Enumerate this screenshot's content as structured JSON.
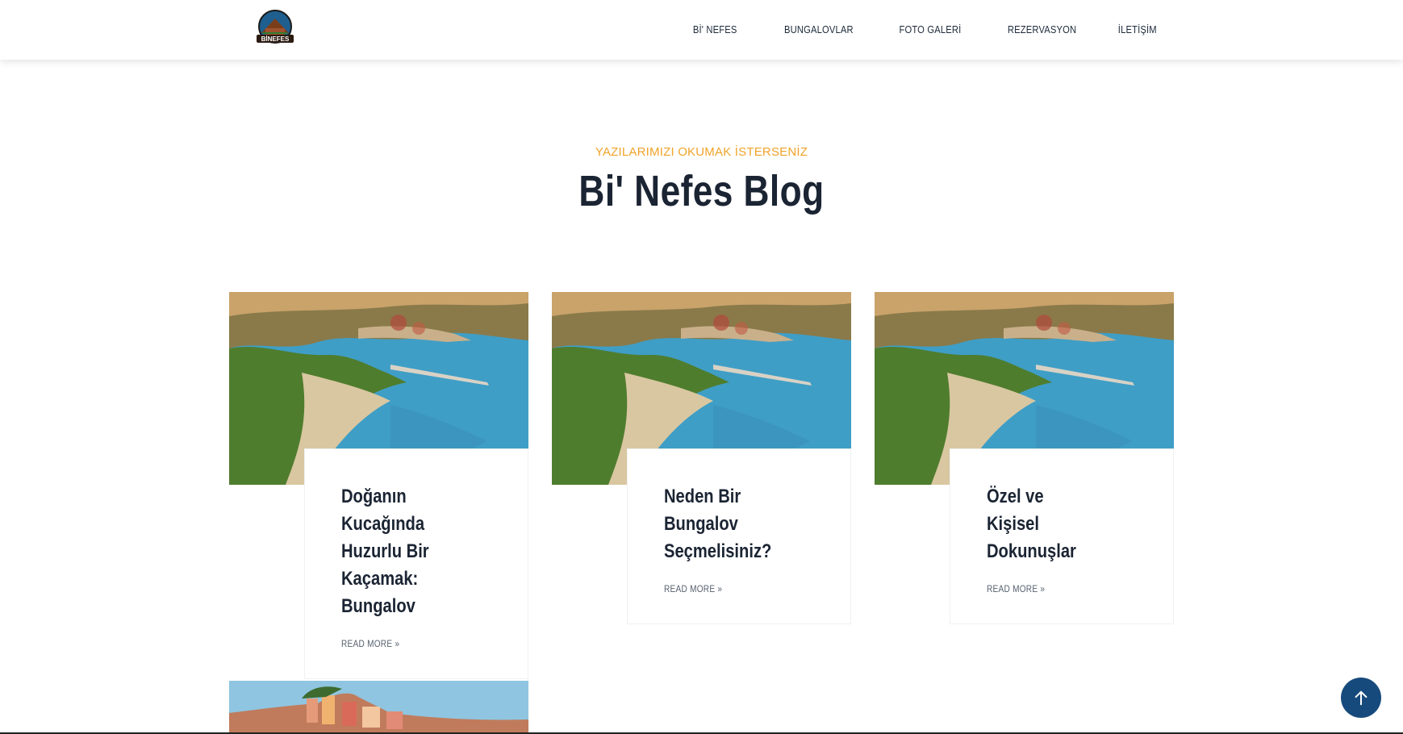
{
  "header": {
    "logo_text": "BİNEFES",
    "nav": [
      {
        "label": "Bİ' NEFES"
      },
      {
        "label": "BUNGALOVLAR"
      },
      {
        "label": "FOTO GALERİ"
      },
      {
        "label": "REZERVASYON"
      },
      {
        "label": "İLETİŞİM"
      }
    ]
  },
  "section": {
    "subtitle": "YAZILARIMIZI OKUMAK İSTERSENİZ",
    "title": "Bi' Nefes Blog"
  },
  "posts": [
    {
      "title": "Doğanın Kucağında Huzurlu Bir Kaçamak: Bungalov",
      "read_more": "READ MORE »"
    },
    {
      "title": "Neden Bir Bungalov Seçmelisiniz?",
      "read_more": "READ MORE »"
    },
    {
      "title": "Özel ve Kişisel Dokunuşlar",
      "read_more": "READ MORE »"
    }
  ],
  "colors": {
    "accent": "#f0a329",
    "heading": "#1b2433",
    "scroll_button": "#174a7c"
  },
  "icons": {
    "scroll_top": "arrow-up-icon"
  }
}
